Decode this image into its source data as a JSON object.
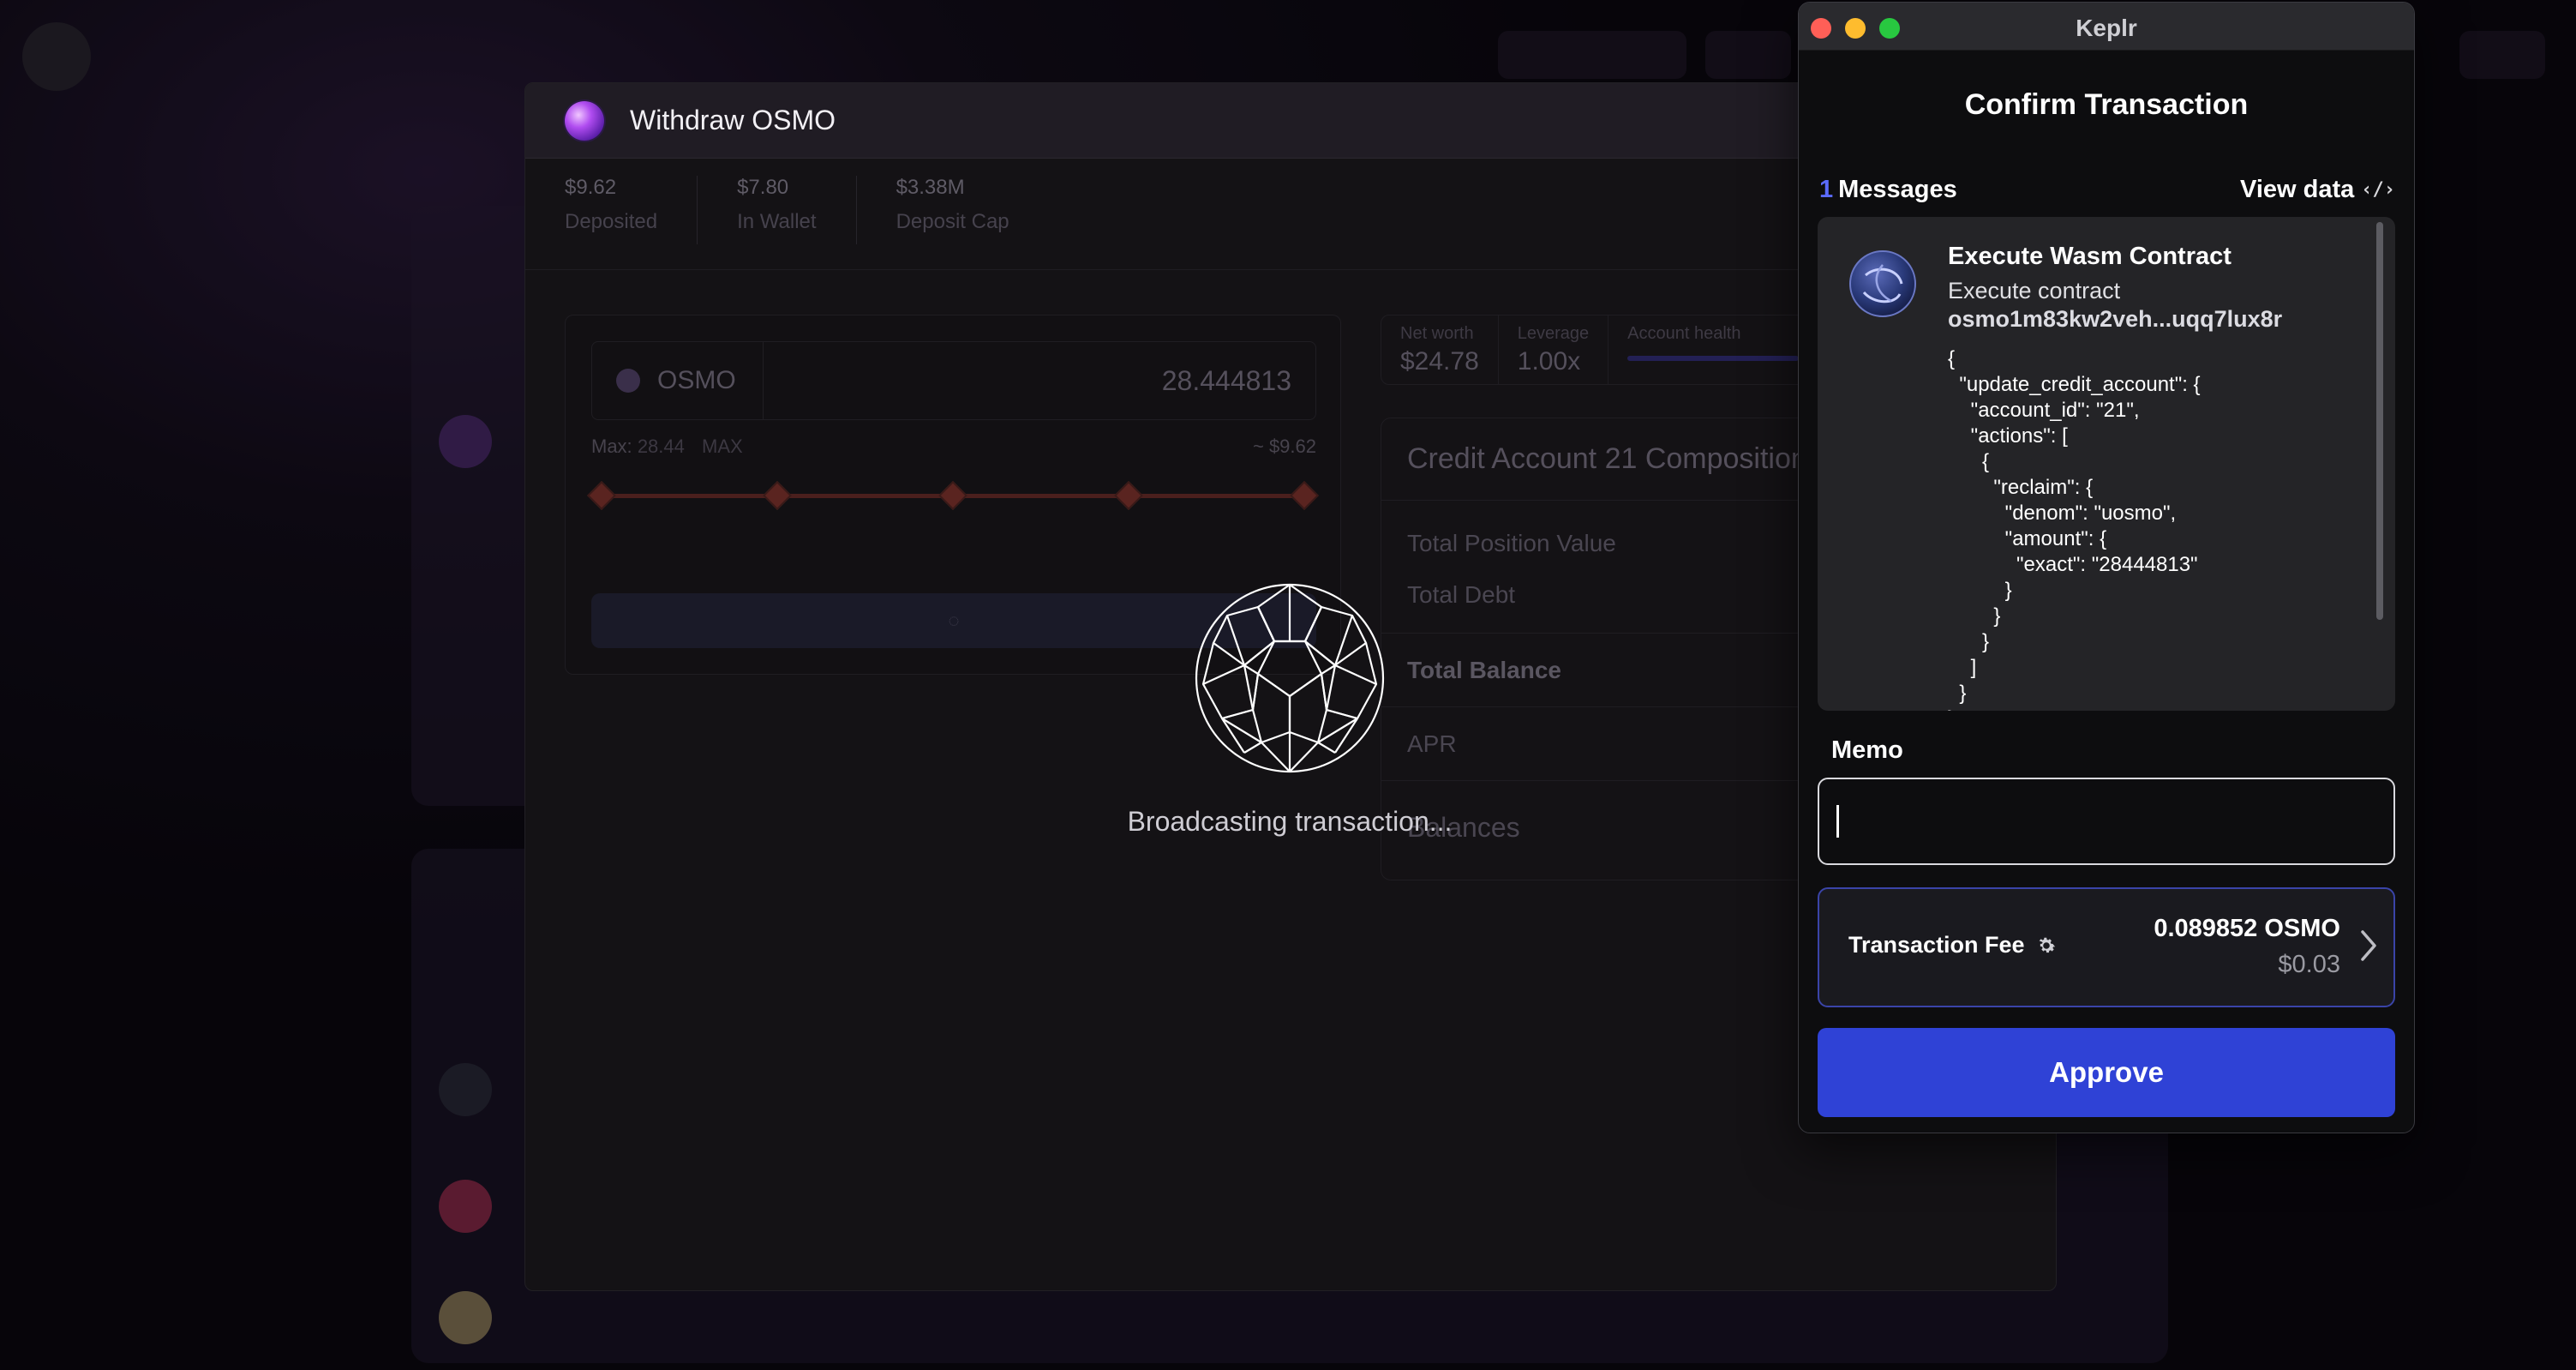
{
  "withdraw_modal": {
    "title": "Withdraw OSMO",
    "stats": [
      {
        "value": "$9.62",
        "label": "Deposited"
      },
      {
        "value": "$7.80",
        "label": "In Wallet"
      },
      {
        "value": "$3.38M",
        "label": "Deposit Cap"
      }
    ],
    "asset_symbol": "OSMO",
    "amount": "28.444813",
    "max_label": "Max:",
    "max_amount": "28.44",
    "max_button": "MAX",
    "usd_value": "~ $9.62",
    "slider_percent": 100,
    "mini_stats": [
      {
        "label": "Net worth",
        "value": "$24.78"
      },
      {
        "label": "Leverage",
        "value": "1.00x"
      },
      {
        "label": "Account health",
        "value": ""
      }
    ],
    "composition": {
      "title": "Credit Account 21 Composition",
      "rows": [
        "Total Position Value",
        "Total Debt",
        "Total Balance",
        "APR",
        "Balances"
      ]
    }
  },
  "broadcast": {
    "text": "Broadcasting transaction..."
  },
  "keplr": {
    "window_title": "Keplr",
    "heading": "Confirm Transaction",
    "messages_count": "1",
    "messages_label": "Messages",
    "view_data_label": "View data",
    "view_data_icon": "code-icon",
    "message": {
      "title": "Execute Wasm Contract",
      "subtitle": "Execute contract",
      "address": "osmo1m83kw2veh...uqq7lux8r",
      "json": "{\n  \"update_credit_account\": {\n    \"account_id\": \"21\",\n    \"actions\": [\n      {\n        \"reclaim\": {\n          \"denom\": \"uosmo\",\n          \"amount\": {\n            \"exact\": \"28444813\"\n          }\n        }\n      }\n    ]\n  }\n}"
    },
    "memo": {
      "label": "Memo",
      "value": "",
      "placeholder": ""
    },
    "fee": {
      "label": "Transaction Fee",
      "amount": "0.089852 OSMO",
      "usd": "$0.03"
    },
    "approve_label": "Approve",
    "colors": {
      "accent": "#2f42d6",
      "count": "#5b6bff",
      "fee_border": "#3a44a8"
    }
  }
}
